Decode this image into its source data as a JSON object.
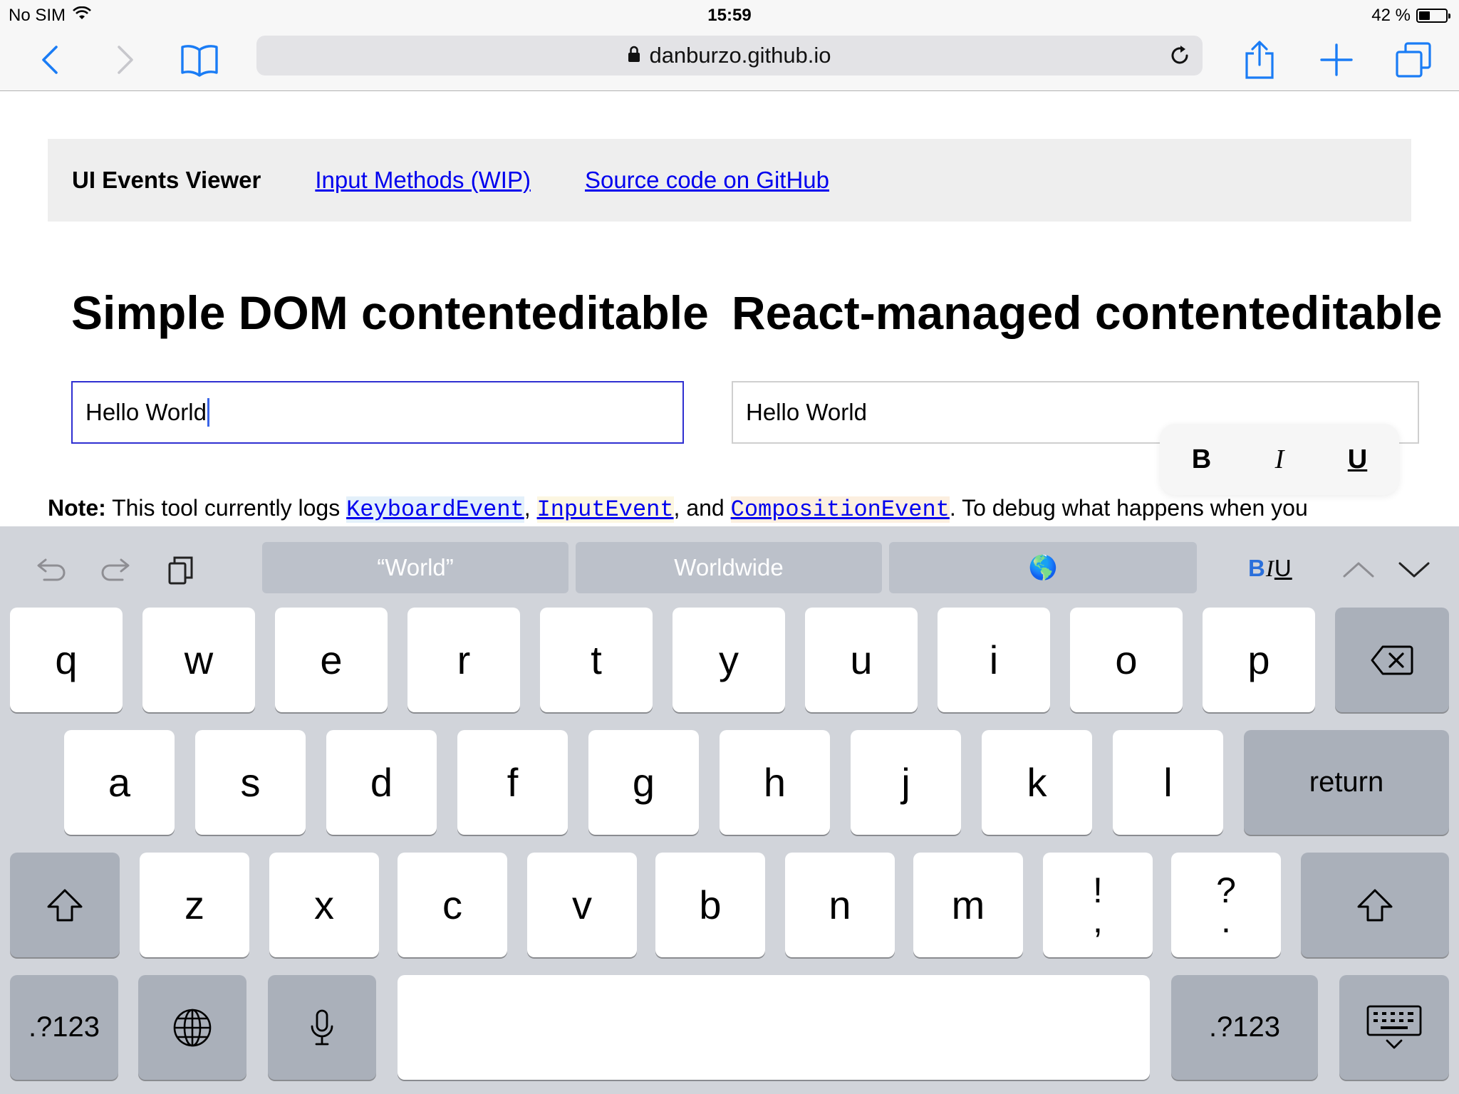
{
  "status_bar": {
    "carrier": "No SIM",
    "time": "15:59",
    "battery_text": "42 %",
    "battery_level": 0.42,
    "wifi_icon": "wifi-icon"
  },
  "browser": {
    "url": "danburzo.github.io",
    "icons": [
      "back-icon",
      "forward-icon",
      "bookmarks-icon",
      "lock-icon",
      "reload-icon",
      "share-icon",
      "new-tab-icon",
      "tabs-icon"
    ]
  },
  "page": {
    "nav": {
      "brand": "UI Events Viewer",
      "links": [
        "Input Methods (WIP)",
        "Source code on GitHub"
      ]
    },
    "left_heading": "Simple DOM contenteditable",
    "right_heading": "React-managed contenteditable",
    "left_editor_value": "Hello World",
    "right_editor_value": "Hello World",
    "format_popup": {
      "bold": "B",
      "italic": "I",
      "underline": "U"
    },
    "note": {
      "label": "Note:",
      "text1": " This tool currently logs ",
      "code1": "KeyboardEvent",
      "sep1": ",",
      "code2": "InputEvent",
      "sep2": ", and ",
      "code3": "CompositionEvent",
      "text2": ". To debug what happens when you"
    }
  },
  "keyboard": {
    "suggestions": [
      "“World”",
      "Worldwide",
      "🌎"
    ],
    "biu": {
      "b": "B",
      "i": "I",
      "u": "U"
    },
    "row1": [
      "q",
      "w",
      "e",
      "r",
      "t",
      "y",
      "u",
      "i",
      "o",
      "p"
    ],
    "row2": [
      "a",
      "s",
      "d",
      "f",
      "g",
      "h",
      "j",
      "k",
      "l"
    ],
    "return_label": "return",
    "row3": [
      "z",
      "x",
      "c",
      "v",
      "b",
      "n",
      "m"
    ],
    "punct1_top": "!",
    "punct1_bottom": ",",
    "punct2_top": "?",
    "punct2_bottom": ".",
    "numbers_label": ".?123",
    "accent_color": "#2a6fdb"
  }
}
